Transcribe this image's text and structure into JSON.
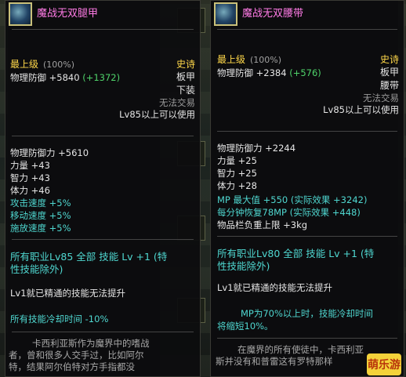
{
  "left": {
    "title": "魔战无双腿甲",
    "rarity": "最上级",
    "rarity_pct": "(100%)",
    "grade": "史诗",
    "slot": "板甲",
    "part": "下装",
    "bind": "无法交易",
    "level_req": "Lv85以上可以使用",
    "base_def": "物理防御 +5840",
    "base_def_bonus": "(+1372)",
    "stats": [
      {
        "text": "物理防御力 +5610",
        "color": "white"
      },
      {
        "text": "力量 +43",
        "color": "white"
      },
      {
        "text": "智力 +43",
        "color": "white"
      },
      {
        "text": "体力 +46",
        "color": "white"
      },
      {
        "text": "攻击速度 +5%",
        "color": "cyan"
      },
      {
        "text": "移动速度 +5%",
        "color": "cyan"
      },
      {
        "text": "施放速度 +5%",
        "color": "cyan"
      }
    ],
    "skill_line1": "所有职业Lv85 全部 技能 Lv +1 (特",
    "skill_line2": "性技能除外)",
    "note": "Lv1就已精通的技能无法提升",
    "cooldown": "所有技能冷却时间 -10%",
    "desc_line1": "卡西利亚斯作为魔界中的嗜战",
    "desc_line2": "者，曾和很多人交手过，比如阿尔",
    "desc_line3": "特，结果阿尔伯特对方手指都没"
  },
  "right": {
    "title": "魔战无双腰带",
    "rarity": "最上级",
    "rarity_pct": "(100%)",
    "grade": "史诗",
    "slot": "板甲",
    "part": "腰带",
    "bind": "无法交易",
    "level_req": "Lv85以上可以使用",
    "base_def": "物理防御 +2384",
    "base_def_bonus": "(+576)",
    "stats": [
      {
        "text": "物理防御力 +2244",
        "color": "white"
      },
      {
        "text": "力量 +25",
        "color": "white"
      },
      {
        "text": "智力 +25",
        "color": "white"
      },
      {
        "text": "体力 +28",
        "color": "white"
      },
      {
        "text": "MP 最大值 +550 (实际效果 +3242)",
        "color": "cyan"
      },
      {
        "text": "每分钟恢复78MP (实际效果 +448)",
        "color": "cyan"
      },
      {
        "text": "物品栏负重上限 +3kg",
        "color": "white"
      }
    ],
    "skill_line1": "所有职业Lv80 全部 技能 Lv +1 (特",
    "skill_line2": "性技能除外)",
    "note": "Lv1就已精通的技能无法提升",
    "cooldown_line1": "MP为70%以上时，技能冷却时间",
    "cooldown_line2": "将缩短10%。",
    "desc_line1": "在魔界的所有使徒中，卡西利亚",
    "desc_line2": "斯并没有和普雷这有罗特那样"
  },
  "watermark": "萌乐游"
}
